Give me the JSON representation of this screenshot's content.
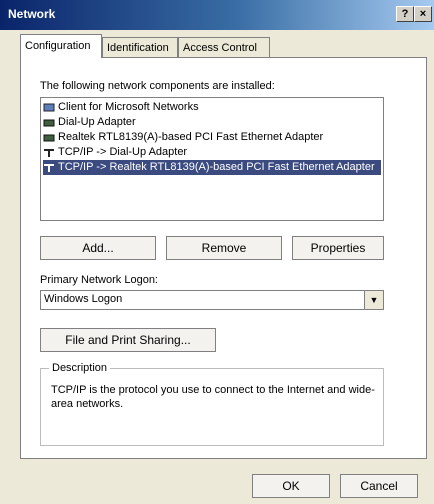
{
  "window": {
    "title": "Network",
    "help_label": "?",
    "close_label": "×"
  },
  "tabs": [
    {
      "label": "Configuration",
      "active": true
    },
    {
      "label": "Identification",
      "active": false
    },
    {
      "label": "Access Control",
      "active": false
    }
  ],
  "components": {
    "heading": "The following network components are installed:",
    "items": [
      {
        "label": "Client for Microsoft Networks",
        "icon": "client-icon"
      },
      {
        "label": "Dial-Up Adapter",
        "icon": "adapter-icon"
      },
      {
        "label": "Realtek RTL8139(A)-based PCI Fast Ethernet Adapter",
        "icon": "adapter-icon"
      },
      {
        "label": "TCP/IP -> Dial-Up Adapter",
        "icon": "protocol-icon"
      },
      {
        "label": "TCP/IP -> Realtek RTL8139(A)-based PCI Fast Ethernet Adapter",
        "icon": "protocol-icon",
        "selected": true
      }
    ]
  },
  "buttons": {
    "add": "Add...",
    "remove": "Remove",
    "properties": "Properties",
    "file_sharing": "File and Print Sharing...",
    "ok": "OK",
    "cancel": "Cancel"
  },
  "logon": {
    "label": "Primary Network Logon:",
    "value": "Windows Logon"
  },
  "description": {
    "title": "Description",
    "text": "TCP/IP is the protocol you use to connect to the Internet and wide-area networks."
  }
}
